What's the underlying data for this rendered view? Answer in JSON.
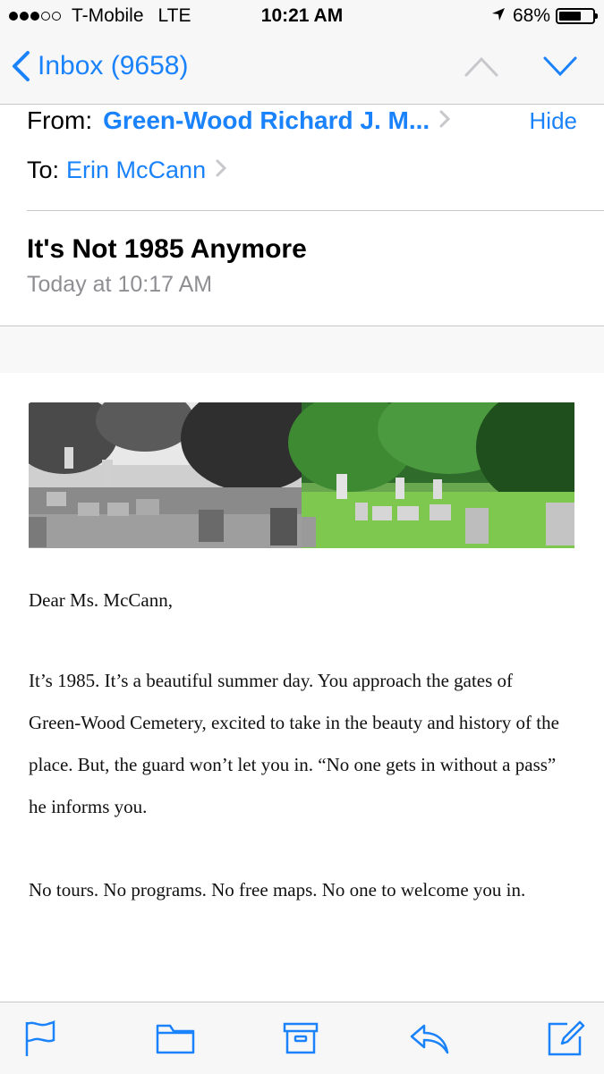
{
  "status_bar": {
    "signal_dots": {
      "filled": 3,
      "total": 5
    },
    "carrier": "T-Mobile",
    "network": "LTE",
    "time": "10:21 AM",
    "battery_percent_label": "68%",
    "battery_level": 0.68
  },
  "nav": {
    "back_label": "Inbox (9658)",
    "icons": [
      "chevron-left-icon",
      "chevron-up-icon",
      "chevron-down-icon"
    ]
  },
  "header": {
    "from_label": "From:",
    "sender": "Green-Wood Richard J. M...",
    "hide_label": "Hide",
    "to_label": "To:",
    "recipient": "Erin McCann",
    "subject": "It's Not 1985 Anymore",
    "date": "Today at 10:17 AM"
  },
  "body": {
    "greeting": "Dear Ms. McCann,",
    "paragraph1": "It’s 1985. It’s a beautiful summer day. You approach the gates of Green-Wood Cemetery, excited to take in the beauty and history of the place. But, the guard won’t let you in. “No one gets in without a pass” he informs you.",
    "paragraph2": "No tours. No programs. No free maps. No one to welcome you in."
  },
  "toolbar": {
    "icons": [
      "flag-icon",
      "folder-icon",
      "archive-icon",
      "reply-icon",
      "compose-icon"
    ]
  },
  "colors": {
    "accent": "#1a82fb",
    "secondary_text": "#8e8e93",
    "bar_background": "#f7f7f7",
    "separator": "#c8c8cc"
  }
}
